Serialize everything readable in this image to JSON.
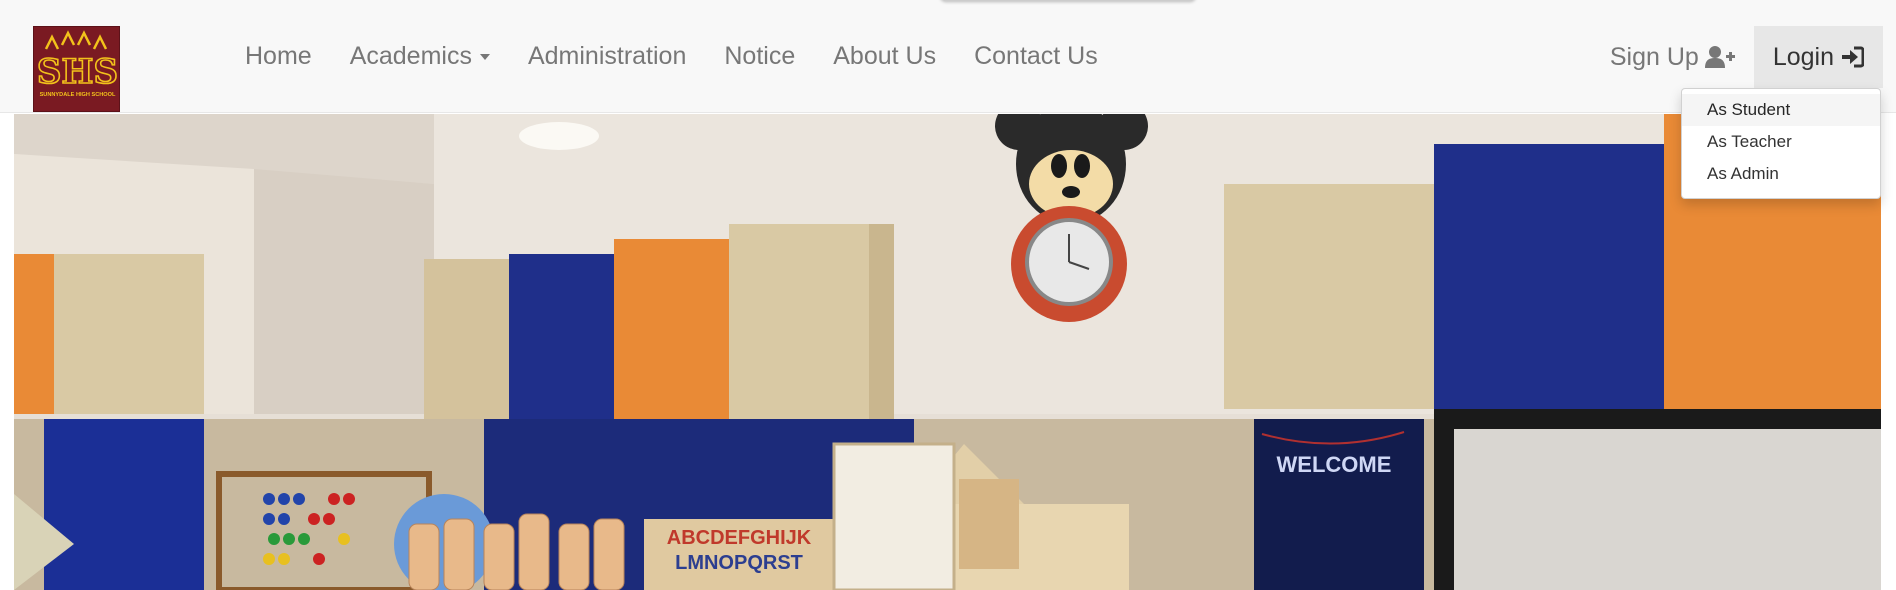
{
  "brand": {
    "initials": "SHS",
    "school_name": "SUNNYDALE HIGH SCHOOL",
    "logo_bg": "#7a1a22",
    "logo_fg": "#f2c21b"
  },
  "nav": {
    "items": [
      {
        "label": "Home"
      },
      {
        "label": "Academics"
      },
      {
        "label": "Administration"
      },
      {
        "label": "Notice"
      },
      {
        "label": "About Us"
      },
      {
        "label": "Contact Us"
      }
    ],
    "signup_label": "Sign Up",
    "login_label": "Login"
  },
  "login_menu": {
    "items": [
      {
        "label": "As Student"
      },
      {
        "label": "As Teacher"
      },
      {
        "label": "As Admin"
      }
    ]
  },
  "hero": {
    "alphabet_row1": "ABCDEFGHIJK",
    "alphabet_row2": "LMNOPQRST",
    "bunting_text": "WELCOME"
  },
  "colors": {
    "navbar_bg": "#f8f8f8",
    "nav_text": "#777777",
    "active_bg": "#e7e7e7",
    "cabinet_blue": "#1f2f8a",
    "cabinet_orange": "#e98a36",
    "cabinet_wood": "#d9c9a4"
  }
}
